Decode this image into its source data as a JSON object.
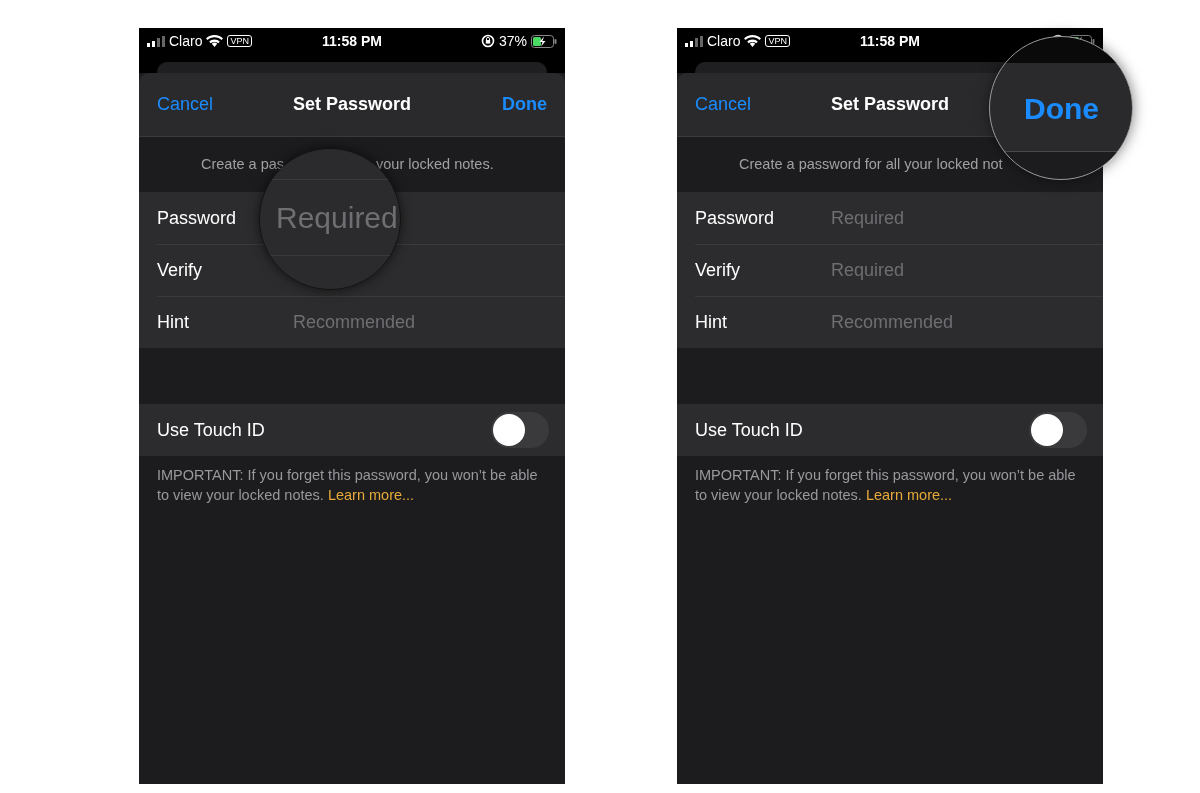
{
  "screens": [
    {
      "status": {
        "carrier": "Claro",
        "vpn": "VPN",
        "time": "11:58 PM",
        "battery": "37%"
      },
      "nav": {
        "cancel": "Cancel",
        "title": "Set Password",
        "done": "Done"
      },
      "description_parts": [
        "Create a pas",
        "your locked notes."
      ],
      "fields": [
        {
          "label": "Password"
        },
        {
          "label": "Verify"
        },
        {
          "label": "Hint",
          "placeholder": "Recommended"
        }
      ],
      "toggle": {
        "label": "Use Touch ID",
        "on": false
      },
      "footer": {
        "text": "IMPORTANT: If you forget this password, you won’t be able to view your locked notes.",
        "link": "Learn more..."
      },
      "magnifier": {
        "kind": "field",
        "placeholder": "Required"
      }
    },
    {
      "status": {
        "carrier": "Claro",
        "vpn": "VPN",
        "time": "11:58 PM"
      },
      "nav": {
        "cancel": "Cancel",
        "title": "Set Password"
      },
      "description_parts": [
        "Create a password for all your locked not"
      ],
      "fields": [
        {
          "label": "Password",
          "placeholder": "Required"
        },
        {
          "label": "Verify",
          "placeholder": "Required"
        },
        {
          "label": "Hint",
          "placeholder": "Recommended"
        }
      ],
      "toggle": {
        "label": "Use Touch ID",
        "on": false
      },
      "footer": {
        "text": "IMPORTANT: If you forget this password, you won’t be able to view your locked notes.",
        "link": "Learn more..."
      },
      "magnifier": {
        "kind": "button",
        "text": "Done"
      }
    }
  ]
}
